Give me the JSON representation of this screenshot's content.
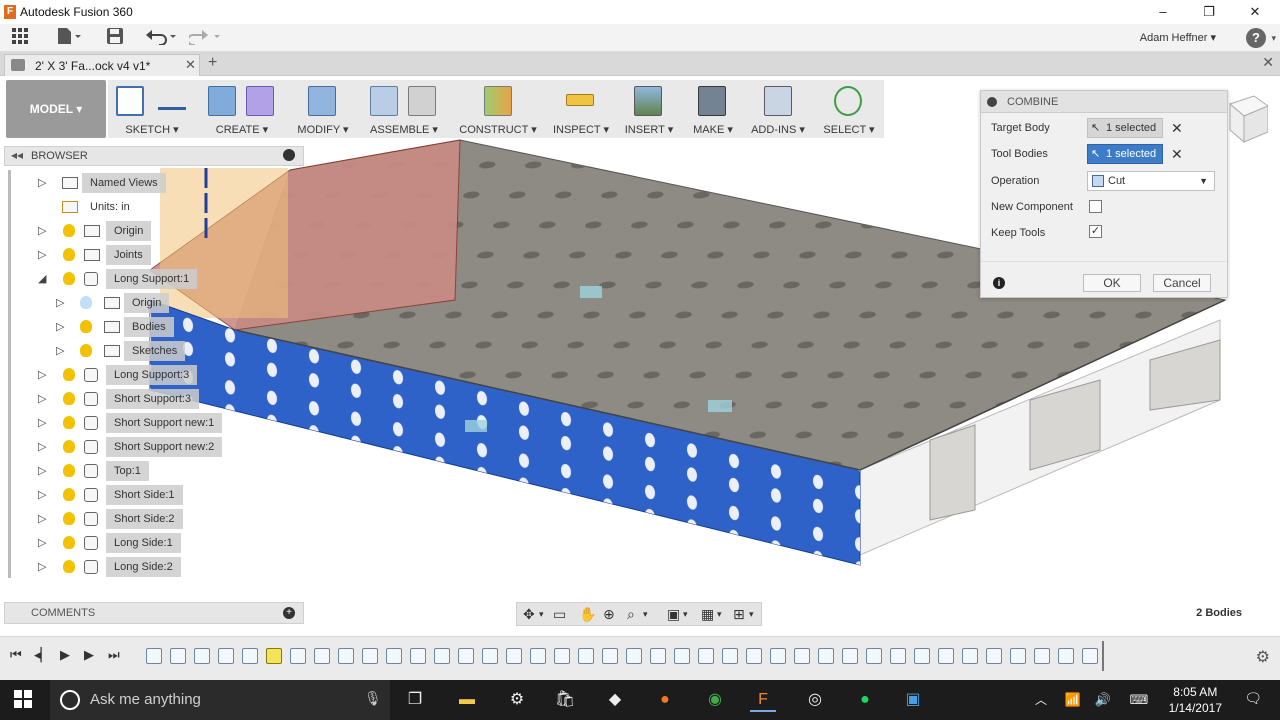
{
  "window": {
    "title": "Autodesk Fusion 360",
    "app_icon": "F",
    "minimize": "–",
    "maximize": "❐",
    "close": "✕"
  },
  "appbar": {
    "user": "Adam Heffner ▾",
    "help": "?"
  },
  "tabs": {
    "doc_name": "2' X 3' Fa...ock v4 v1*",
    "close": "✕",
    "add": "+",
    "close_all": "✕"
  },
  "toolbar": {
    "mode": "MODEL ▾",
    "groups": [
      "SKETCH ▾",
      "CREATE ▾",
      "MODIFY ▾",
      "ASSEMBLE ▾",
      "CONSTRUCT ▾",
      "INSPECT ▾",
      "INSERT ▾",
      "MAKE ▾",
      "ADD-INS ▾",
      "SELECT ▾"
    ]
  },
  "browser": {
    "title": "BROWSER",
    "items": [
      {
        "label": "Named Views"
      },
      {
        "label": "Units: in"
      },
      {
        "label": "Origin"
      },
      {
        "label": "Joints"
      },
      {
        "label": "Long Support:1"
      },
      {
        "label": "Origin"
      },
      {
        "label": "Bodies"
      },
      {
        "label": "Sketches"
      },
      {
        "label": "Long Support:3"
      },
      {
        "label": "Short Support:3"
      },
      {
        "label": "Short Support new:1"
      },
      {
        "label": "Short Support new:2"
      },
      {
        "label": "Top:1"
      },
      {
        "label": "Short Side:1"
      },
      {
        "label": "Short Side:2"
      },
      {
        "label": "Long Side:1"
      },
      {
        "label": "Long Side:2"
      }
    ]
  },
  "comments": {
    "title": "COMMENTS",
    "add": "+"
  },
  "status": {
    "bodies": "2 Bodies"
  },
  "combine": {
    "title": "COMBINE",
    "target_label": "Target Body",
    "target_value": "1 selected",
    "tool_label": "Tool Bodies",
    "tool_value": "1 selected",
    "operation_label": "Operation",
    "operation_value": "Cut",
    "new_component_label": "New Component",
    "new_component_checked": false,
    "keep_tools_label": "Keep Tools",
    "keep_tools_checked": true,
    "checkmark": "✓",
    "ok": "OK",
    "cancel": "Cancel"
  },
  "taskbar": {
    "search_placeholder": "Ask me anything",
    "time": "8:05 AM",
    "date": "1/14/2017"
  },
  "colors": {
    "accent": "#3d7cc9",
    "blue_panel": "#2f62c8",
    "sheet": "#8e8a84",
    "bulb": "#f2c200"
  }
}
